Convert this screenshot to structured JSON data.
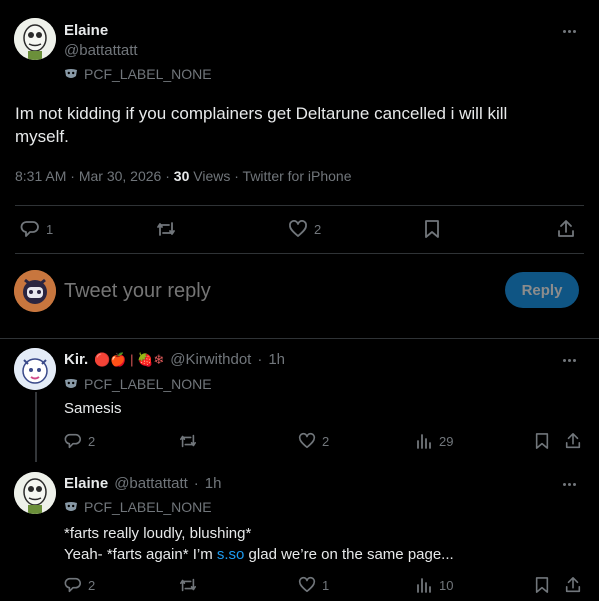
{
  "main_tweet": {
    "author_name": "Elaine",
    "author_handle": "@battattatt",
    "label": "PCF_LABEL_NONE",
    "text": "Im not kidding if you complainers get Deltarune cancelled i will kill myself.",
    "time": "8:31 AM",
    "date": "Mar 30, 2026",
    "views_count": "30",
    "views_label": "Views",
    "source": "Twitter for iPhone",
    "reply_count": "1",
    "retweet_count": "",
    "like_count": "2"
  },
  "reply_box": {
    "placeholder": "Tweet your reply",
    "button_label": "Reply"
  },
  "replies": [
    {
      "author_name": "Kir.",
      "emoji": "🔴🍎 | 🍓❄",
      "author_handle": "@Kirwithdot",
      "time": "1h",
      "label": "PCF_LABEL_NONE",
      "text": "Samesis",
      "reply_count": "2",
      "like_count": "2",
      "views_count": "29"
    },
    {
      "author_name": "Elaine",
      "author_handle": "@battattatt",
      "time": "1h",
      "label": "PCF_LABEL_NONE",
      "text_line1": "*farts really loudly, blushing*",
      "text_line2_a": "Yeah- *farts again* I’m ",
      "text_line2_link": "s.so",
      "text_line2_b": " glad we’re on the same page...",
      "reply_count": "2",
      "like_count": "1",
      "views_count": "10"
    }
  ],
  "colors": {
    "background": "#000000",
    "text": "#e7e9ea",
    "muted": "#71767b",
    "accent": "#1d9bf0",
    "reply_button": "#1d9bf0",
    "divider": "#2f3336"
  }
}
